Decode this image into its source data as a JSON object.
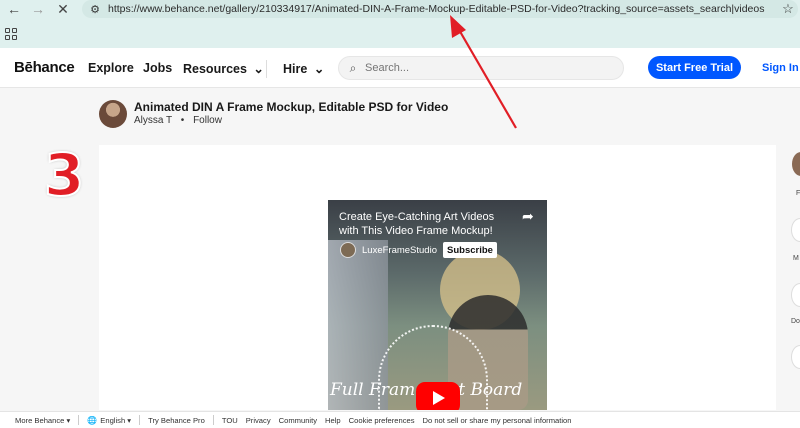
{
  "browser": {
    "url": "https://www.behance.net/gallery/210334917/Animated-DIN-A-Frame-Mockup-Editable-PSD-for-Video?tracking_source=assets_search|videos",
    "back_icon": "←",
    "forward_icon": "→",
    "stop_icon": "✕",
    "tune_icon": "⚙",
    "star_icon": "☆"
  },
  "header": {
    "logo": "Bēhance",
    "nav": {
      "explore": "Explore",
      "jobs": "Jobs",
      "resources": "Resources",
      "hire": "Hire"
    },
    "chevron": "⌄",
    "search_placeholder": "Search...",
    "search_icon": "⌕",
    "start_trial": "Start Free Trial",
    "sign_in": "Sign In"
  },
  "project": {
    "title": "Animated DIN A Frame Mockup, Editable PSD for Video",
    "owner": "Alyssa T",
    "separator": "•",
    "follow": "Follow"
  },
  "annotation": {
    "number": "3",
    "arrow_color": "#e11e26"
  },
  "video": {
    "title": "Create Eye-Catching Art Videos with This Video Frame Mockup!",
    "channel": "LuxeFrameStudio",
    "subscribe": "Subscribe",
    "overlay_text": "Full Frame Mat Board",
    "share_icon": "➦"
  },
  "rail": {
    "labels": [
      "F",
      "M",
      "Do"
    ]
  },
  "footer": {
    "more_behance": "More Behance ▾",
    "language": "English ▾",
    "globe_icon": "🌐",
    "try_pro": "Try Behance Pro",
    "links": [
      "TOU",
      "Privacy",
      "Community",
      "Help",
      "Cookie preferences",
      "Do not sell or share my personal information"
    ]
  },
  "colors": {
    "brand_blue": "#0057ff",
    "chrome_bg": "#dff0ee",
    "youtube_red": "#ff0000"
  }
}
